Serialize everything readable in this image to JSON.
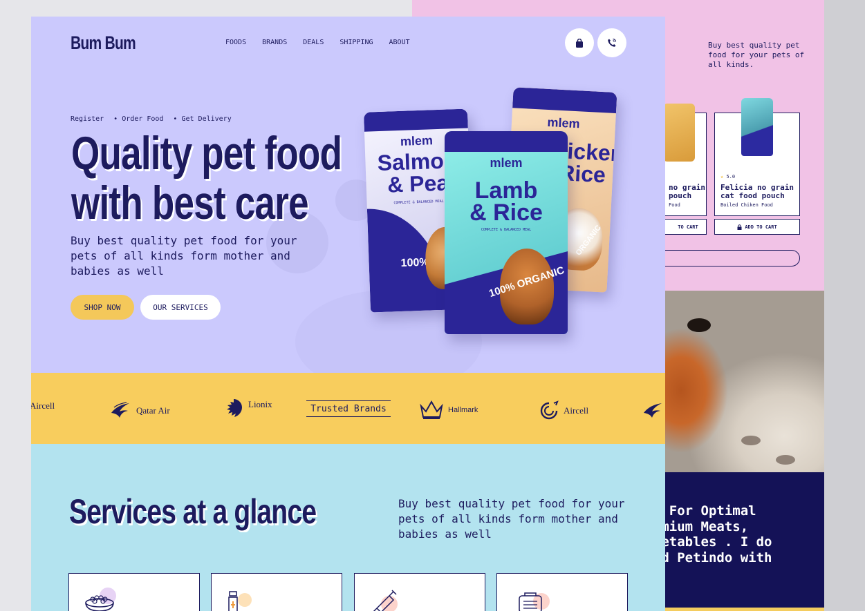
{
  "brand": {
    "logo": "Bum Bum"
  },
  "nav": {
    "items": [
      "FOODS",
      "BRANDS",
      "DEALS",
      "SHIPPING",
      "ABOUT"
    ]
  },
  "header_icons": [
    "shopping-bag-icon",
    "phone-icon"
  ],
  "hero": {
    "steps": [
      "Register",
      "• Order Food",
      "• Get Delivery"
    ],
    "title_line1": "Quality pet food",
    "title_line2": "with best care",
    "lead": "Buy best quality pet food for your pets of all kinds form mother and babies as well",
    "shop_button": "SHOP NOW",
    "services_button": "OUR SERVICES"
  },
  "bags": [
    {
      "brand": "mlem",
      "title_line1": "Salmon",
      "title_line2": "& Pea",
      "sub": "COMPLETE & BALANCED MEAL",
      "badge": "100%"
    },
    {
      "brand": "mlem",
      "title_line1": "Chicken",
      "title_line2": "& Rice",
      "badge": "ORGANIC"
    },
    {
      "brand": "mlem",
      "title_line1": "Lamb",
      "title_line2": "& Rice",
      "sub": "COMPLETE & BALANCED MEAL",
      "badge": "100%",
      "badge2": "ORGANIC"
    }
  ],
  "brands_strip": {
    "items": [
      "Aircell",
      "Qatar Air",
      "Lionix",
      "Hallmark",
      "Aircell"
    ],
    "center_label": "Trusted Brands"
  },
  "services": {
    "title": "Services at a glance",
    "lead": "Buy best quality pet food for your pets of all kinds form mother and babies as well",
    "card_icons": [
      "food-bowl-icon",
      "bottle-icon",
      "syringe-icon",
      "pet-carrier-icon"
    ]
  },
  "side_panel": {
    "lead": "Buy best quality pet food for your pets of all kinds.",
    "product_left": {
      "name_line1": "no grain",
      "name_line2": "pouch",
      "sub": "Food",
      "cart": "TO CART"
    },
    "product_right": {
      "rating": "5.0",
      "name_line1": "Felicia no grain",
      "name_line2": "cat food pouch",
      "sub": "Boiled Chiken Food",
      "cart": "ADD TO CART"
    },
    "quote": "ied For Optimal\n Premium Meats,\nVegetables . I  do\nmend Petindo with\n.\""
  },
  "colors": {
    "hero_bg": "#cbc9fd",
    "navy": "#1d1b5e",
    "yellow": "#f8cd5d",
    "services_bg": "#b3e3ef",
    "pink": "#f1c2e6",
    "quote_bg": "#141257"
  }
}
